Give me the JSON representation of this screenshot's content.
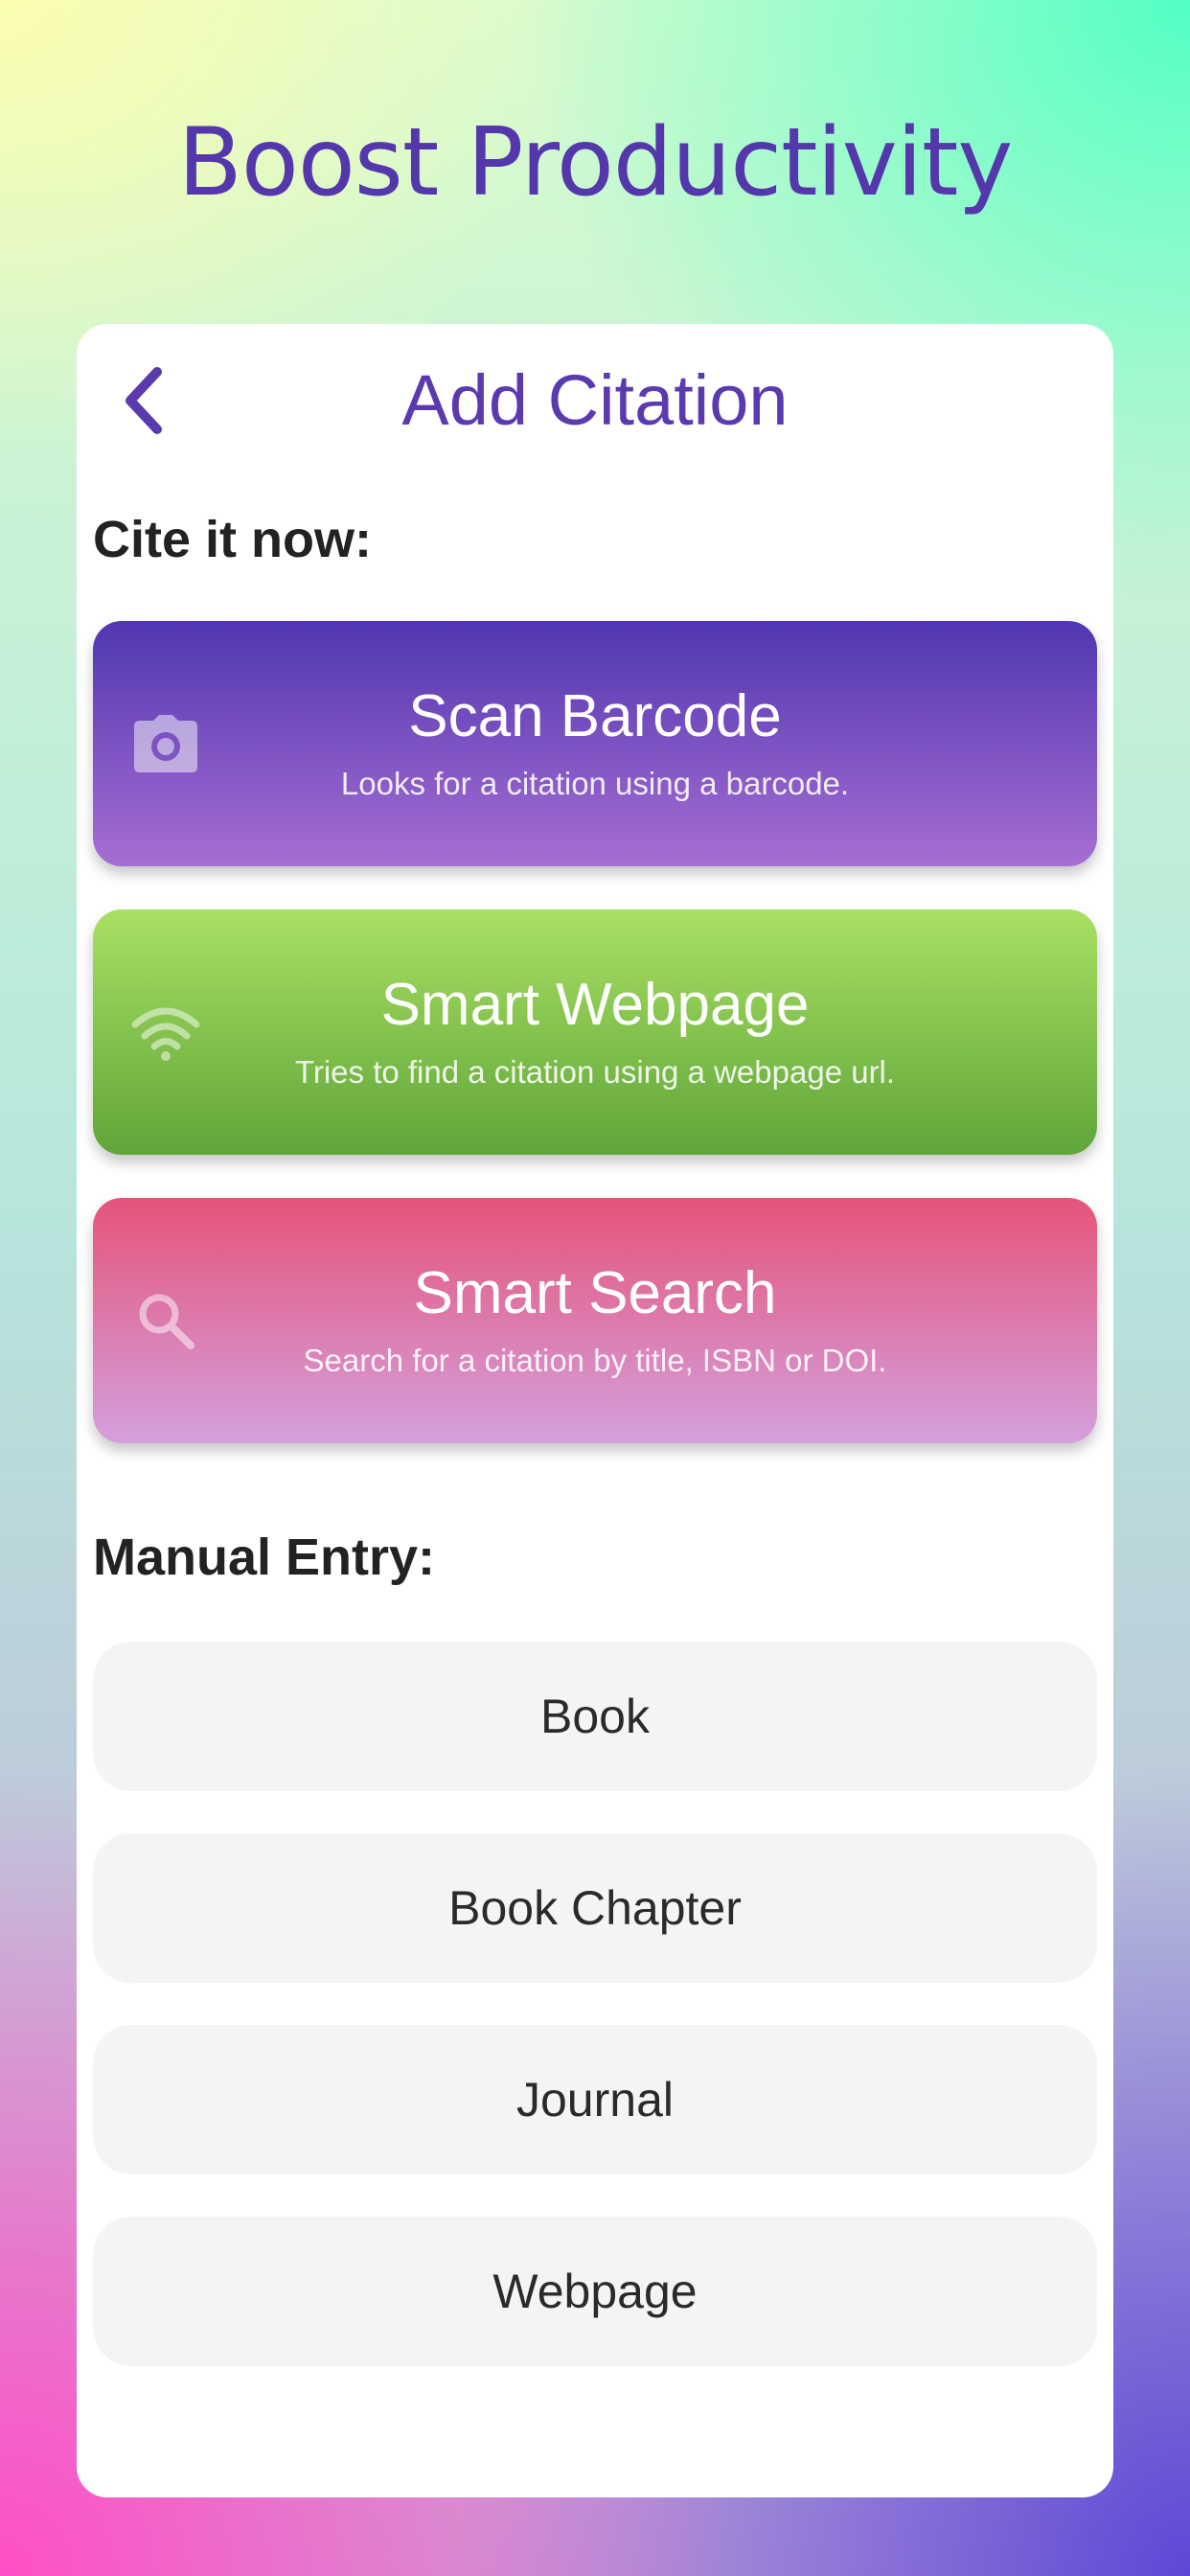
{
  "headline": "Boost Productivity",
  "header": {
    "title": "Add Citation",
    "back_icon": "chevron-left-icon"
  },
  "quick_section": {
    "label": "Cite it now:",
    "actions": [
      {
        "title": "Scan Barcode",
        "subtitle": "Looks for a citation using a barcode.",
        "icon": "camera-icon",
        "gradient": [
          "#5037b1",
          "#a76ed2"
        ]
      },
      {
        "title": "Smart Webpage",
        "subtitle": "Tries to find a citation using a webpage url.",
        "icon": "wifi-icon",
        "gradient": [
          "#a9e063",
          "#5fa539"
        ]
      },
      {
        "title": "Smart Search",
        "subtitle": "Search for a citation by title, ISBN or DOI.",
        "icon": "search-icon",
        "gradient": [
          "#e5547a",
          "#d4a0dd"
        ]
      }
    ]
  },
  "manual_section": {
    "label": "Manual Entry:",
    "items": [
      "Book",
      "Book Chapter",
      "Journal",
      "Webpage"
    ]
  },
  "colors": {
    "accent": "#5b3ab0",
    "headline": "#5537ac",
    "manual_bg": "#f4f4f4"
  }
}
